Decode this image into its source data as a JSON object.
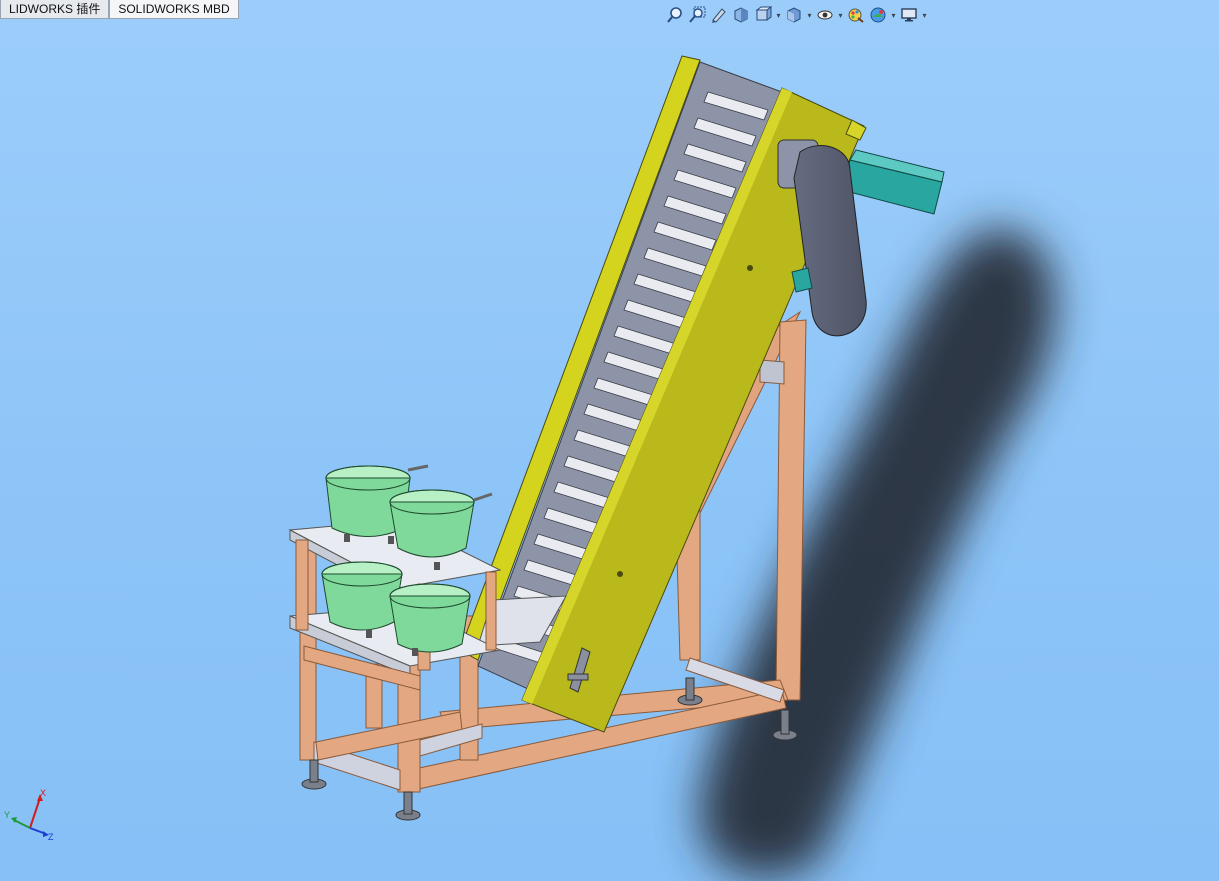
{
  "tabs": [
    {
      "label": "LIDWORKS 插件",
      "active": false
    },
    {
      "label": "SOLIDWORKS MBD",
      "active": true
    }
  ],
  "hud_toolbar": {
    "icons": [
      "zoom-to-fit-icon",
      "zoom-to-area-icon",
      "previous-view-icon",
      "section-view-icon",
      "view-orientation-icon",
      "display-style-icon",
      "hide-show-items-icon",
      "edit-appearance-icon",
      "apply-scene-icon",
      "view-settings-icon"
    ]
  },
  "triad": {
    "x_label": "Y",
    "y_label": "X",
    "z_label": "Z"
  },
  "colors": {
    "background": "#93c8f9",
    "frame_wood": "#e3a882",
    "conveyor_yellow": "#b9b91c",
    "bowl_green": "#7fd99a",
    "motor_gray": "#5c6274",
    "chute_teal": "#2aa6a0",
    "shadow": "#26303d"
  }
}
